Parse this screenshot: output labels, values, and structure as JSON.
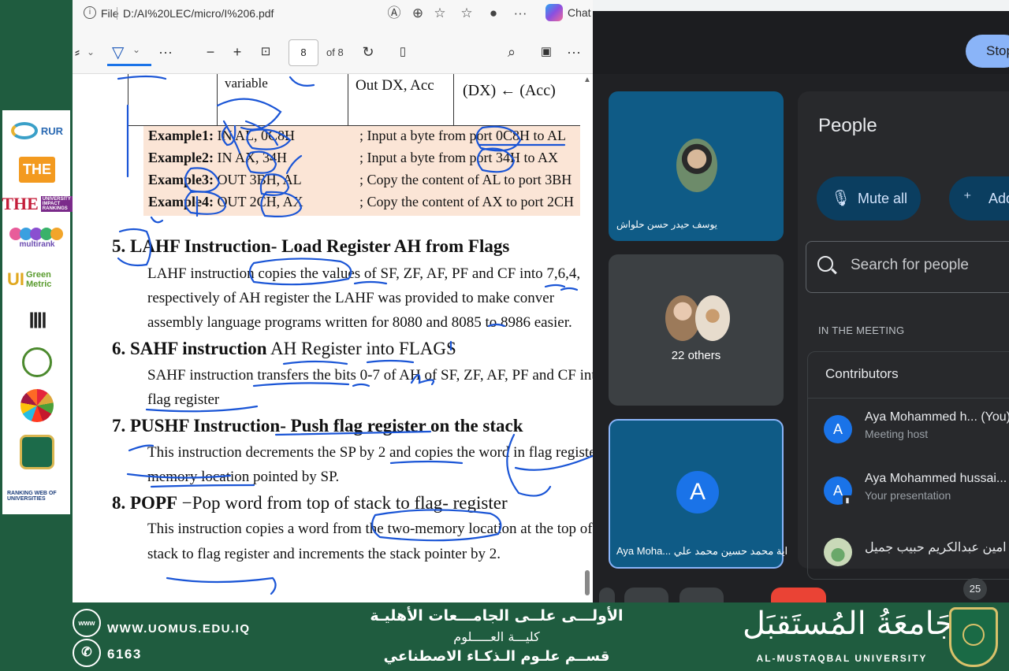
{
  "browser": {
    "file_label": "File",
    "url": "D:/AI%20LEC/micro/I%206.pdf",
    "copilot_label": "Chat",
    "more_label": "···"
  },
  "pdf_toolbar": {
    "page_current": "8",
    "page_of": "of 8",
    "more_label": "···",
    "zoom_out": "−",
    "zoom_in": "+",
    "more_right": "···"
  },
  "pdf": {
    "table_top": {
      "col1": "variable",
      "col2": "Out DX, Acc",
      "col3": "(DX) ← (Acc)"
    },
    "examples": [
      {
        "label": "Example1:",
        "code": " IN AL, 0C8H",
        "comment": "; Input a byte from port 0C8H to AL"
      },
      {
        "label": "Example2:",
        "code": " IN AX, 34H",
        "comment": "; Input a byte from port 34H to AX"
      },
      {
        "label": "Example3:",
        "code": " OUT 3BH, AL",
        "comment": "; Copy the content of AL to port 3BH"
      },
      {
        "label": "Example4:",
        "code": " OUT 2CH, AX",
        "comment": "; Copy the content of AX to port 2CH"
      }
    ],
    "sec5_title": "5. LAHF Instruction- Load Register AH from Flags",
    "sec5_lines": [
      "LAHF instruction copies the values of SF, ZF, AF, PF and CF into 7,6,4,",
      "respectively of AH register the LAHF was provided to make conver",
      "assembly language programs written for 8080 and 8085 to 8986 easier."
    ],
    "sec6_title": "6. SAHF instruction",
    "sec6_title_rest": " AH Register into FLAGS",
    "sec6_lines": [
      "SAHF instruction transfers the bits 0-7 of AH of SF, ZF, AF, PF and CF into",
      "flag register"
    ],
    "sec7_title": "7. PUSHF Instruction- Push flag register on the stack",
    "sec7_lines": [
      "This instruction decrements the SP by 2 and copies the word in flag register",
      "memory location pointed by SP."
    ],
    "sec8_title": "8. POPF",
    "sec8_title_rest": " −Pop word from top of stack to flag- register",
    "sec8_lines": [
      "This instruction copies a word from the two-memory location at the top of tl",
      "stack to flag register and increments the stack pointer by 2."
    ]
  },
  "ink_color": "#1a55d6",
  "meet": {
    "stop_label": "Stop",
    "tile1_name": "يوسف حيدر حسن حلواش",
    "tile2_label": "22 others",
    "tile3_avatar": "A",
    "tile3_name": "Aya Moha... اية محمد حسين محمد علي",
    "people_title": "People",
    "mute_all": "Mute all",
    "add_label": "Add",
    "search_placeholder": "Search for people",
    "in_meeting": "IN THE MEETING",
    "contributors": "Contributors",
    "participants": [
      {
        "avatar": "A",
        "name": "Aya Mohammed h... (You)",
        "role": "Meeting host"
      },
      {
        "avatar": "A",
        "name": "Aya Mohammed hussai...",
        "role": "Your presentation"
      },
      {
        "avatar": "",
        "name": "امين عبدالكريم حبيب جميل",
        "role": ""
      }
    ],
    "participant_count": "25"
  },
  "footer": {
    "website": "WWW.UOMUS.EDU.IQ",
    "phone": "6163",
    "www_icon": "www",
    "phone_icon": "✆",
    "ar_line1": "الأولـــى علــى الجامـــعات الأهليـة",
    "ar_line2": "كليـــة العـــــلوم",
    "ar_line3": "قســم علـوم الـذكـاء الاصطناعي",
    "uni_ar": "جَامعَةُ المُستَقبَل",
    "uni_en": "AL-MUSTAQBAL UNIVERSITY"
  },
  "logos": {
    "rur": "RUR",
    "the": "THE",
    "the_impact": "THE",
    "the_impact_sub": "UNIVERSITY IMPACT RANKINGS",
    "multirank": "multirank",
    "greenmetric": "Green Metric",
    "greenmetric_u": "UI",
    "webometrics": "RANKING WEB OF UNIVERSITIES"
  }
}
